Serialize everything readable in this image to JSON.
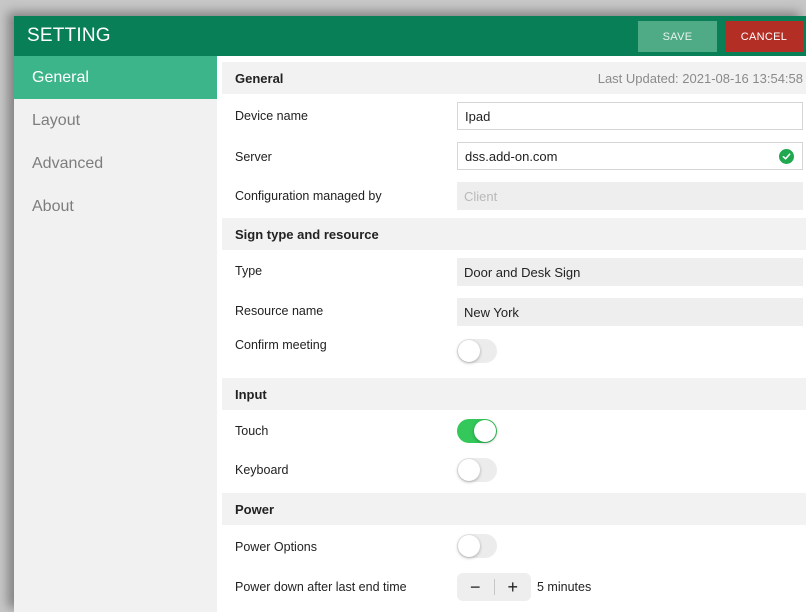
{
  "header": {
    "title": "SETTING",
    "save_label": "SAVE",
    "cancel_label": "CANCEL"
  },
  "sidebar": {
    "items": [
      {
        "label": "General",
        "active": true
      },
      {
        "label": "Layout"
      },
      {
        "label": "Advanced"
      },
      {
        "label": "About"
      }
    ]
  },
  "general": {
    "title": "General",
    "last_updated": "Last Updated: 2021-08-16 13:54:58",
    "device_name_label": "Device name",
    "device_name_value": "Ipad",
    "server_label": "Server",
    "server_value": "dss.add-on.com",
    "config_label": "Configuration managed by",
    "config_value": "Client"
  },
  "sign": {
    "title": "Sign type and resource",
    "type_label": "Type",
    "type_value": "Door and Desk Sign",
    "resource_label": "Resource name",
    "resource_value": "New York",
    "confirm_label": "Confirm meeting",
    "confirm_on": false
  },
  "input": {
    "title": "Input",
    "touch_label": "Touch",
    "touch_on": true,
    "keyboard_label": "Keyboard",
    "keyboard_on": false
  },
  "power": {
    "title": "Power",
    "options_label": "Power Options",
    "options_on": false,
    "powerdown_label": "Power down after last end time",
    "minus_symbol": "−",
    "plus_symbol": "+",
    "powerdown_value": "5 minutes"
  },
  "colors": {
    "header": "#087f57",
    "sidebar_active": "#3db58a",
    "save": "#4faa86",
    "cancel": "#b32e24",
    "toggle_on": "#34c759",
    "check": "#1fa84d"
  },
  "icons": {
    "server_status": "check-circle-icon"
  }
}
